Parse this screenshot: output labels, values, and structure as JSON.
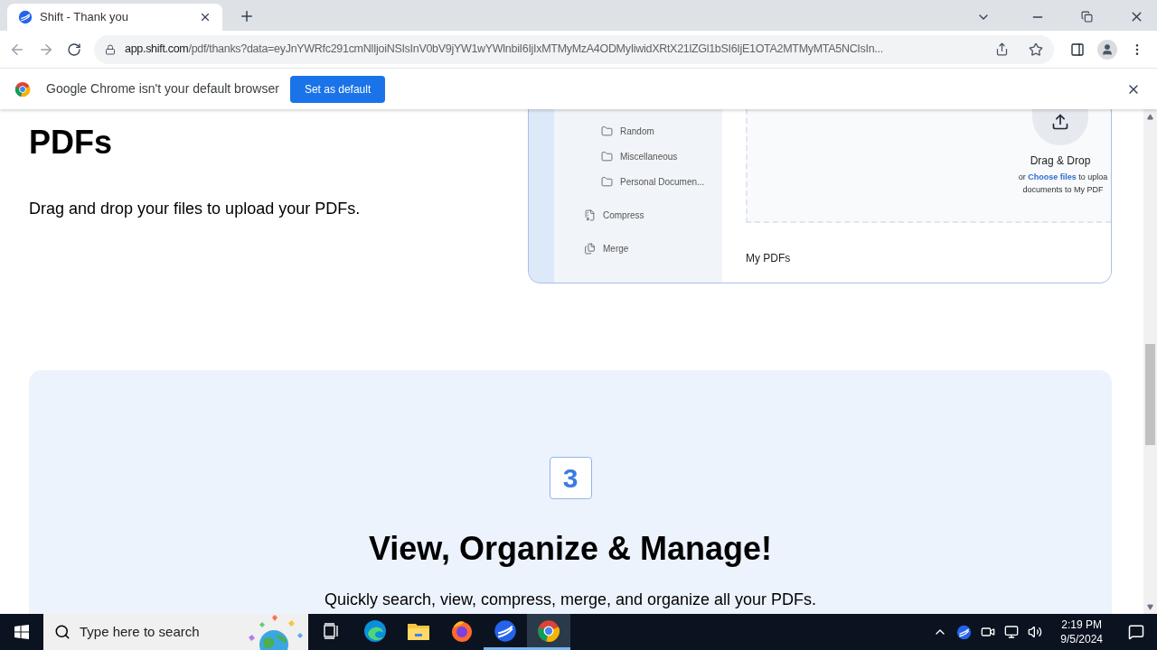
{
  "browser": {
    "tabs": [
      {
        "title": "Shift - Thank you",
        "selected": true
      }
    ],
    "url": {
      "host": "app.shift.com",
      "path": "/pdf/thanks?data=eyJnYWRfc291cmNlIjoiNSIsInV0bV9jYW1wYWlnbiI6IjIxMTMyMzA4ODMyIiwidXRtX21lZGl1bSI6IjE1OTA2MTMyMTA5NCIsIn..."
    },
    "infobar": {
      "message": "Google Chrome isn't your default browser",
      "button": "Set as default"
    }
  },
  "page": {
    "step2": {
      "heading": "PDFs",
      "text": "Drag and drop your files to upload your PDFs.",
      "preview": {
        "sidebar": [
          {
            "kind": "folder",
            "label": "Random"
          },
          {
            "kind": "folder",
            "label": "Miscellaneous"
          },
          {
            "kind": "folder",
            "label": "Personal Documen..."
          },
          {
            "kind": "compress",
            "label": "Compress"
          },
          {
            "kind": "merge",
            "label": "Merge"
          }
        ],
        "drop_title": "Drag & Drop",
        "drop_prefix": "or",
        "drop_link": "Choose files",
        "drop_suffix": "to uploa",
        "drop_line2": "documents to My PDF",
        "list_title": "My PDFs"
      }
    },
    "step3": {
      "number": "3",
      "heading": "View, Organize & Manage!",
      "text": "Quickly search, view, compress, merge, and organize all your PDFs."
    }
  },
  "taskbar": {
    "search_placeholder": "Type here to search",
    "apps": [
      {
        "kind": "taskview",
        "running": false,
        "selected": false
      },
      {
        "kind": "edge",
        "running": false,
        "selected": false
      },
      {
        "kind": "explorer",
        "running": false,
        "selected": false
      },
      {
        "kind": "firefox",
        "running": false,
        "selected": false
      },
      {
        "kind": "shift",
        "running": true,
        "selected": false
      },
      {
        "kind": "chrome",
        "running": true,
        "selected": true
      }
    ],
    "time": "2:19 PM",
    "date": "9/5/2024"
  }
}
